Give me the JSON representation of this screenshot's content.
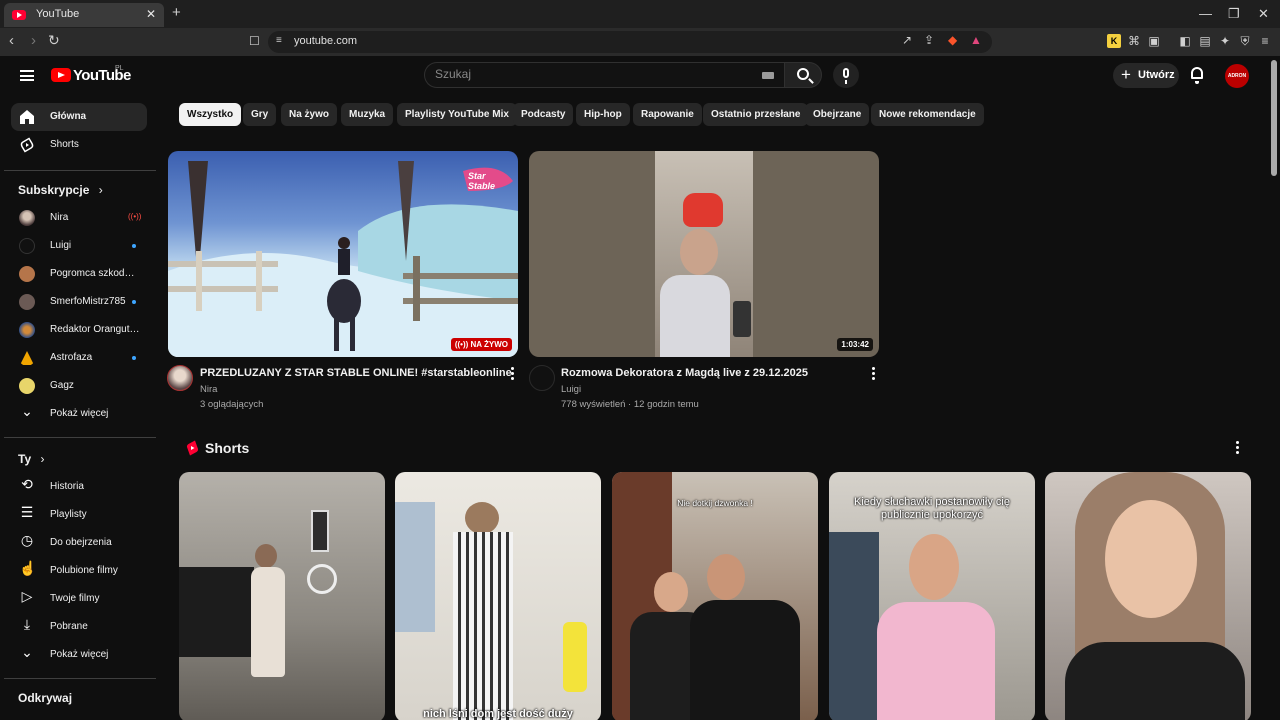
{
  "browser": {
    "tab_title": "YouTube",
    "tab_close": "✕",
    "new_tab": "+",
    "url": "youtube.com",
    "window_controls": {
      "minimize": "—",
      "restore": "❐",
      "close": "✕"
    }
  },
  "header": {
    "logo_text": "YouTube",
    "country_code": "PL",
    "search_placeholder": "Szukaj",
    "create_label": "Utwórz",
    "avatar_text": "ADRON"
  },
  "sidebar": {
    "main": [
      {
        "label": "Główna",
        "icon": "home-icon"
      },
      {
        "label": "Shorts",
        "icon": "shorts-icon"
      }
    ],
    "subscriptions_heading": "Subskrypcje",
    "subscriptions": [
      {
        "name": "Nira",
        "status": "live"
      },
      {
        "name": "Luigi",
        "status": "new"
      },
      {
        "name": "Pogromca szkodników",
        "status": ""
      },
      {
        "name": "SmerfoMistrz785",
        "status": "new"
      },
      {
        "name": "Redaktor Orangutan",
        "status": ""
      },
      {
        "name": "Astrofaza",
        "status": "new"
      },
      {
        "name": "Gagz",
        "status": ""
      }
    ],
    "show_more": "Pokaż więcej",
    "you_heading": "Ty",
    "you_items": [
      {
        "label": "Historia",
        "icon": "history-icon"
      },
      {
        "label": "Playlisty",
        "icon": "playlist-icon"
      },
      {
        "label": "Do obejrzenia",
        "icon": "clock-icon"
      },
      {
        "label": "Polubione filmy",
        "icon": "thumb-up-icon"
      },
      {
        "label": "Twoje filmy",
        "icon": "video-icon"
      },
      {
        "label": "Pobrane",
        "icon": "download-icon"
      },
      {
        "label": "Pokaż więcej",
        "icon": "chevron-down-icon"
      }
    ],
    "explore_heading": "Odkrywaj"
  },
  "chips": [
    "Wszystko",
    "Gry",
    "Na żywo",
    "Muzyka",
    "Playlisty YouTube Mix",
    "Podcasty",
    "Hip-hop",
    "Rapowanie",
    "Ostatnio przesłane",
    "Obejrzane",
    "Nowe rekomendacje"
  ],
  "videos": [
    {
      "title": "PRZEDLUZANY Z STAR STABLE ONLINE! #starstableonline",
      "channel": "Nira",
      "meta": "3 oglądających",
      "badge": "NA ŻYWO",
      "thumb_logo": "Star Stable"
    },
    {
      "title": "Rozmowa Dekoratora z Magdą live z 29.12.2025",
      "channel": "Luigi",
      "meta": "778 wyświetleń · 12 godzin temu",
      "badge": "1:03:42"
    }
  ],
  "shorts": {
    "heading": "Shorts",
    "items": [
      {
        "caption_top": "",
        "caption_bottom": ""
      },
      {
        "caption_top": "",
        "caption_bottom": "nich lśni dom jest dość duży"
      },
      {
        "caption_top": "Nie dotkij dzwonka !",
        "caption_bottom": ""
      },
      {
        "caption_top": "Kiedy słuchawki postanowiły cię publicznie upokorzyć",
        "caption_bottom": ""
      },
      {
        "caption_top": "",
        "caption_bottom": ""
      }
    ]
  }
}
